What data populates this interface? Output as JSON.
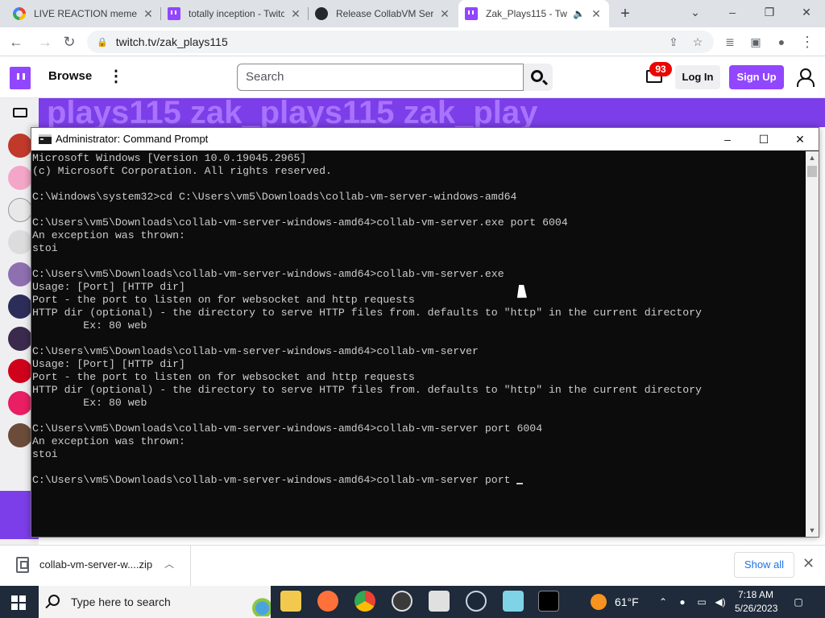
{
  "browser": {
    "tabs": [
      {
        "title": "LIVE REACTION meme",
        "icon": "google-icon"
      },
      {
        "title": "totally inception - Twitc",
        "icon": "twitch-icon"
      },
      {
        "title": "Release CollabVM Serv",
        "icon": "github-icon"
      },
      {
        "title": "Zak_Plays115 - Tw",
        "icon": "twitch-icon",
        "active": true,
        "audio": true
      }
    ],
    "url": "twitch.tv/zak_plays115"
  },
  "twitch": {
    "browse_label": "Browse",
    "search_placeholder": "Search",
    "notification_count": "93",
    "login_label": "Log In",
    "signup_label": "Sign Up",
    "banner_text": "plays115 zak_plays115 zak_play",
    "brand_color": "#9146ff"
  },
  "cmd": {
    "title": "Administrator: Command Prompt",
    "lines": [
      "Microsoft Windows [Version 10.0.19045.2965]",
      "(c) Microsoft Corporation. All rights reserved.",
      "",
      "C:\\Windows\\system32>cd C:\\Users\\vm5\\Downloads\\collab-vm-server-windows-amd64",
      "",
      "C:\\Users\\vm5\\Downloads\\collab-vm-server-windows-amd64>collab-vm-server.exe port 6004",
      "An exception was thrown:",
      "stoi",
      "",
      "C:\\Users\\vm5\\Downloads\\collab-vm-server-windows-amd64>collab-vm-server.exe",
      "Usage: [Port] [HTTP dir]",
      "Port - the port to listen on for websocket and http requests",
      "HTTP dir (optional) - the directory to serve HTTP files from. defaults to \"http\" in the current directory",
      "        Ex: 80 web",
      "",
      "C:\\Users\\vm5\\Downloads\\collab-vm-server-windows-amd64>collab-vm-server",
      "Usage: [Port] [HTTP dir]",
      "Port - the port to listen on for websocket and http requests",
      "HTTP dir (optional) - the directory to serve HTTP files from. defaults to \"http\" in the current directory",
      "        Ex: 80 web",
      "",
      "C:\\Users\\vm5\\Downloads\\collab-vm-server-windows-amd64>collab-vm-server port 6004",
      "An exception was thrown:",
      "stoi",
      "",
      "C:\\Users\\vm5\\Downloads\\collab-vm-server-windows-amd64>collab-vm-server port "
    ]
  },
  "downloads": {
    "file_name": "collab-vm-server-w....zip",
    "show_all_label": "Show all"
  },
  "taskbar": {
    "search_placeholder": "Type here to search",
    "weather": "61°F",
    "time": "7:18 AM",
    "date": "5/26/2023"
  }
}
